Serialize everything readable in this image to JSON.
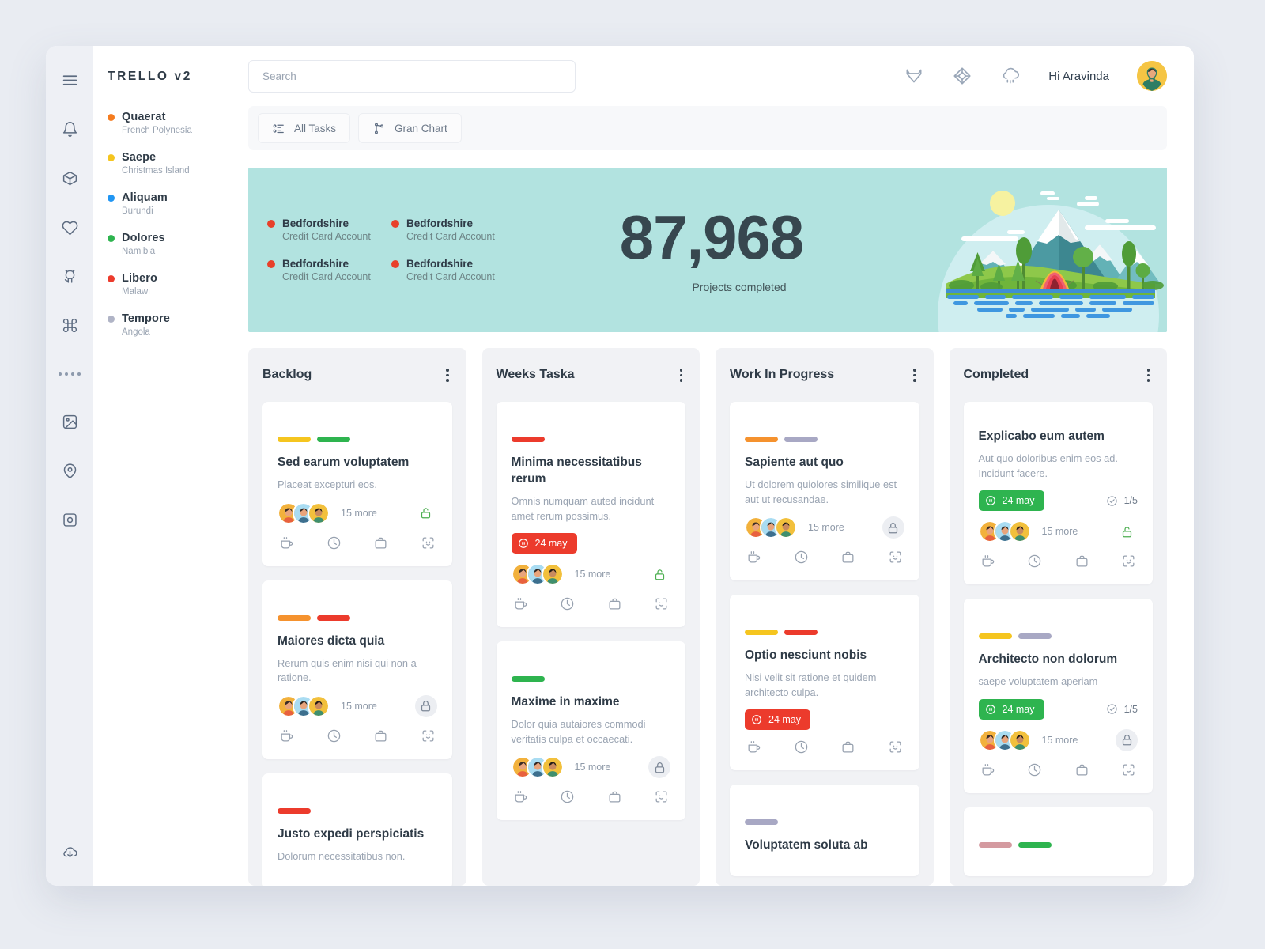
{
  "brand": "TRELLO v2",
  "rail": {
    "icons": [
      {
        "name": "menu-icon"
      },
      {
        "name": "bell-icon"
      },
      {
        "name": "box-icon"
      },
      {
        "name": "heart-icon"
      },
      {
        "name": "github-icon"
      },
      {
        "name": "command-icon"
      },
      {
        "name": "dots-icon"
      },
      {
        "name": "image-icon"
      },
      {
        "name": "location-pin-icon"
      },
      {
        "name": "aperture-icon"
      },
      {
        "name": "cloud-download-icon"
      }
    ]
  },
  "projects": [
    {
      "name": "Quaerat",
      "location": "French Polynesia",
      "color": "#f57c1f"
    },
    {
      "name": "Saepe",
      "location": "Christmas Island",
      "color": "#f5c51f"
    },
    {
      "name": "Aliquam",
      "location": "Burundi",
      "color": "#2196f3"
    },
    {
      "name": "Dolores",
      "location": "Namibia",
      "color": "#2eb44f"
    },
    {
      "name": "Libero",
      "location": "Malawi",
      "color": "#ec3b2c"
    },
    {
      "name": "Tempore",
      "location": "Angola",
      "color": "#b0b4c6"
    }
  ],
  "search": {
    "placeholder": "Search",
    "value": ""
  },
  "header": {
    "greeting": "Hi Aravinda",
    "icons": [
      "gitlab-icon",
      "cube-icon",
      "rain-cloud-icon"
    ]
  },
  "tabs": [
    {
      "label": "All Tasks",
      "icon": "list-icon"
    },
    {
      "label": "Gran Chart",
      "icon": "git-branch-icon"
    }
  ],
  "hero": {
    "background": "#b2e3e0",
    "number": "87,968",
    "caption": "Projects completed",
    "accounts": [
      {
        "name": "Bedfordshire",
        "sub": "Credit Card Account",
        "color": "#e8402a"
      },
      {
        "name": "Bedfordshire",
        "sub": "Credit Card Account",
        "color": "#e8402a"
      },
      {
        "name": "Bedfordshire",
        "sub": "Credit Card Account",
        "color": "#e8402a"
      },
      {
        "name": "Bedfordshire",
        "sub": "Credit Card Account",
        "color": "#e8402a"
      }
    ]
  },
  "board": {
    "columns": [
      {
        "title": "Backlog",
        "cards": [
          {
            "pills": [
              "#f5c51f",
              "#2eb44f"
            ],
            "title": "Sed earum voluptatem",
            "desc": "Placeat excepturi eos.",
            "date": null,
            "checklist": null,
            "avatars": 3,
            "more": "15 more",
            "lock": "unlocked"
          },
          {
            "pills": [
              "#f5922e",
              "#ec3b2c"
            ],
            "title": "Maiores dicta quia",
            "desc": "Rerum quis enim nisi qui non a ratione.",
            "date": null,
            "checklist": null,
            "avatars": 3,
            "more": "15 more",
            "lock": "locked"
          },
          {
            "pills": [
              "#ec3b2c"
            ],
            "title": "Justo expedi perspiciatis",
            "desc": "Dolorum necessitatibus non.",
            "date": null,
            "checklist": null,
            "avatars": 0,
            "more": null,
            "lock": null
          }
        ]
      },
      {
        "title": "Weeks Taska",
        "cards": [
          {
            "pills": [
              "#ec3b2c"
            ],
            "title": "Minima necessitatibus rerum",
            "desc": "Omnis numquam auted incidunt amet rerum possimus.",
            "date": "24 may",
            "date_color": "#ec3b2c",
            "checklist": null,
            "avatars": 3,
            "more": "15 more",
            "lock": "unlocked"
          },
          {
            "pills": [
              "#2eb44f"
            ],
            "title": "Maxime in maxime",
            "desc": "Dolor quia autaiores commodi veritatis culpa et occaecati.",
            "date": null,
            "checklist": null,
            "avatars": 3,
            "more": "15 more",
            "lock": "locked"
          }
        ]
      },
      {
        "title": "Work In Progress",
        "cards": [
          {
            "pills": [
              "#f5922e",
              "#a8a8c4"
            ],
            "title": "Sapiente aut quo",
            "desc": "Ut dolorem quiolores similique est aut ut recusandae.",
            "date": null,
            "checklist": null,
            "avatars": 3,
            "more": "15 more",
            "lock": "locked"
          },
          {
            "pills": [
              "#f5c51f",
              "#ec3b2c"
            ],
            "title": "Optio nesciunt nobis",
            "desc": "Nisi velit sit ratione et quidem architecto culpa.",
            "date": "24 may",
            "date_color": "#ec3b2c",
            "checklist": null,
            "avatars": 0,
            "more": null,
            "lock": null
          },
          {
            "pills": [
              "#a8a8c4"
            ],
            "title": "Voluptatem soluta ab",
            "desc": null,
            "date": null,
            "checklist": null,
            "avatars": 0,
            "more": null,
            "lock": null
          }
        ]
      },
      {
        "title": "Completed",
        "cards": [
          {
            "pills": [],
            "title": "Explicabo eum autem",
            "desc": "Aut quo doloribus enim eos ad. Incidunt facere.",
            "date": "24 may",
            "date_color": "#2eb44f",
            "checklist": "1/5",
            "avatars": 3,
            "more": "15 more",
            "lock": "unlocked"
          },
          {
            "pills": [
              "#f5c51f",
              "#a8a8c4"
            ],
            "title": "Architecto non dolorum",
            "desc": "saepe voluptatem aperiam",
            "date": "24 may",
            "date_color": "#2eb44f",
            "checklist": "1/5",
            "avatars": 3,
            "more": "15 more",
            "lock": "locked"
          },
          {
            "pills": [
              "#d49aa0",
              "#2eb44f"
            ],
            "title": null,
            "desc": null,
            "date": null,
            "checklist": null,
            "avatars": 0,
            "more": null,
            "lock": null
          }
        ]
      }
    ]
  }
}
